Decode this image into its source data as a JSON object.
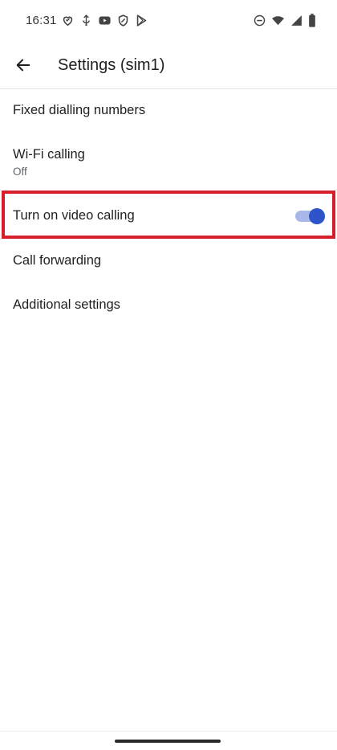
{
  "status_bar": {
    "time": "16:31",
    "left_icons": [
      "heart-chat-icon",
      "usb-debug-icon",
      "youtube-icon",
      "shield-icon",
      "play-store-icon"
    ],
    "right_icons": [
      "do-not-disturb-icon",
      "wifi-icon",
      "cellular-signal-icon",
      "battery-icon"
    ]
  },
  "app_bar": {
    "back_icon": "arrow-back-icon",
    "title": "Settings (sim1)"
  },
  "settings": {
    "items": [
      {
        "title": "Fixed dialling numbers"
      },
      {
        "title": "Wi-Fi calling",
        "subtitle": "Off"
      },
      {
        "title": "Turn on video calling",
        "toggle_on": true
      },
      {
        "title": "Call forwarding"
      },
      {
        "title": "Additional settings"
      }
    ]
  },
  "colors": {
    "highlight": "#d71f29",
    "toggle_knob": "#2d55c9",
    "toggle_track": "#a9b8e8"
  }
}
